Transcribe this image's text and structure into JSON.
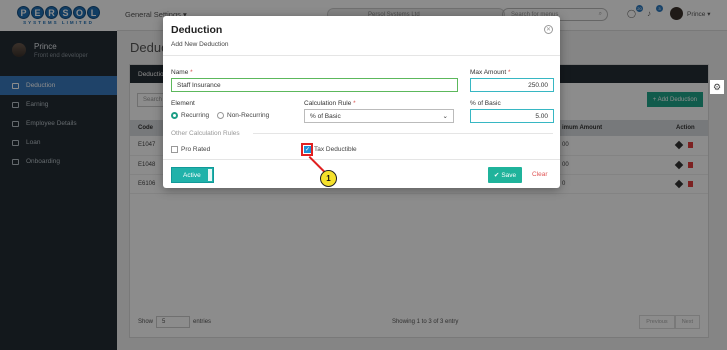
{
  "logo": {
    "text": "PERSOL",
    "letters": [
      "P",
      "E",
      "R",
      "S",
      "O",
      "L"
    ],
    "sub": "SYSTEMS LIMITED"
  },
  "user": {
    "name": "Prince",
    "role": "Front end developer",
    "top_name": "Prince ▾"
  },
  "sidebar": {
    "items": [
      {
        "label": "Deduction",
        "active": true
      },
      {
        "label": "Earning"
      },
      {
        "label": "Employee Details"
      },
      {
        "label": "Loan"
      },
      {
        "label": "Onboarding"
      }
    ]
  },
  "topbar": {
    "menu": "General Settings ▾",
    "company": "Persol Systems Ltd",
    "search_placeholder": "Search for menus",
    "badge1": "20",
    "badge2": "3"
  },
  "page": {
    "title": "Deduc",
    "card_title": "Deductio",
    "search_placeholder": "Search",
    "add_button": "+ Add Deduction"
  },
  "table": {
    "headers": {
      "code": "Code",
      "max_amount": "imum Amount",
      "action": "Action"
    },
    "rows": [
      {
        "code": "E1047",
        "amount": "00"
      },
      {
        "code": "E1048",
        "amount": "00"
      },
      {
        "code": "E6106",
        "amount": "0"
      }
    ]
  },
  "footer": {
    "show_label": "Show",
    "show_value": "5",
    "entries_label": "entries",
    "info": "Showing 1 to 3 of 3 entry",
    "prev": "Previous",
    "next": "Next"
  },
  "modal": {
    "title": "Deduction",
    "subtitle": "Add New Deduction",
    "name_label": "Name",
    "name_value": "Staff Insurance",
    "max_amount_label": "Max Amount",
    "max_amount_value": "250.00",
    "element_label": "Element",
    "radio_recurring": "Recurring",
    "radio_nonrecurring": "Non-Recurring",
    "calc_rule_label": "Calculation Rule",
    "calc_rule_value": "% of Basic",
    "pct_basic_label": "% of Basic",
    "pct_basic_value": "5.00",
    "other_rules_label": "Other Calculation Rules",
    "pro_rated_label": "Pro Rated",
    "tax_deductible_label": "Tax Deductible",
    "active_label": "Active",
    "save_label": "Save",
    "clear_label": "Clear",
    "required_mark": "*"
  },
  "callout": {
    "number": "1"
  },
  "colors": {
    "accent": "#20b2aa",
    "sidebar_active": "#3a7bbf",
    "highlight": "#e02020",
    "marker": "#f5e12b"
  }
}
